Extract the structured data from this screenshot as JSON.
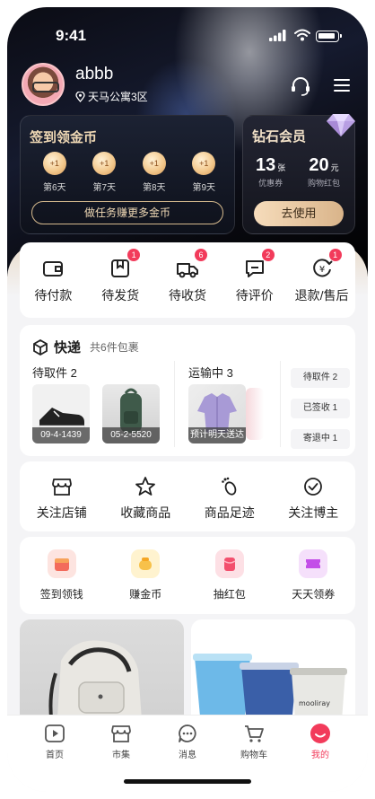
{
  "status_bar": {
    "time": "9:41"
  },
  "profile": {
    "username": "abbb",
    "location": "天马公寓3区"
  },
  "signin": {
    "title": "签到领金币",
    "days": [
      {
        "reward": "+1",
        "label": "第6天"
      },
      {
        "reward": "+1",
        "label": "第7天"
      },
      {
        "reward": "+1",
        "label": "第8天"
      },
      {
        "reward": "+1",
        "label": "第9天"
      }
    ],
    "task_button": "做任务赚更多金币"
  },
  "membership": {
    "title": "钻石会员",
    "coupons": {
      "value": "13",
      "unit": "张",
      "label": "优惠券"
    },
    "red_packet": {
      "value": "20",
      "unit": "元",
      "label": "购物红包"
    },
    "button": "去使用"
  },
  "orders": [
    {
      "label": "待付款",
      "icon": "wallet-icon",
      "badge": ""
    },
    {
      "label": "待发货",
      "icon": "package-icon",
      "badge": "1"
    },
    {
      "label": "待收货",
      "icon": "truck-icon",
      "badge": "6"
    },
    {
      "label": "待评价",
      "icon": "comment-icon",
      "badge": "2"
    },
    {
      "label": "退款/售后",
      "icon": "refund-icon",
      "badge": "1"
    }
  ],
  "express": {
    "title": "快递",
    "count_text": "共6件包裹",
    "pickup_title": "待取件 2",
    "pickup_items": [
      {
        "code": "09-4-1439",
        "icon": "sneaker-image"
      },
      {
        "code": "05-2-5520",
        "icon": "backpack-image"
      }
    ],
    "transit_title": "运输中 3",
    "transit_items": [
      {
        "code": "预计明天送达",
        "icon": "jacket-image"
      }
    ],
    "status_pills": [
      {
        "label": "待取件",
        "count": "2"
      },
      {
        "label": "已签收",
        "count": "1"
      },
      {
        "label": "寄退中",
        "count": "1"
      }
    ]
  },
  "shortcuts": [
    {
      "label": "关注店铺",
      "icon": "store-icon"
    },
    {
      "label": "收藏商品",
      "icon": "star-icon"
    },
    {
      "label": "商品足迹",
      "icon": "footprint-icon"
    },
    {
      "label": "关注博主",
      "icon": "check-circle-icon"
    }
  ],
  "activities": [
    {
      "label": "签到领钱",
      "icon": "calendar-gift-icon",
      "color": "#f36b5c"
    },
    {
      "label": "赚金币",
      "icon": "coin-jar-icon",
      "color": "#f7c14a"
    },
    {
      "label": "抽红包",
      "icon": "red-packet-icon",
      "color": "#f3506e"
    },
    {
      "label": "天天领券",
      "icon": "ticket-icon",
      "color": "#c34ee8"
    }
  ],
  "tabbar": [
    {
      "label": "首页",
      "icon": "play-icon",
      "active": false
    },
    {
      "label": "市集",
      "icon": "market-icon",
      "active": false
    },
    {
      "label": "消息",
      "icon": "chat-icon",
      "active": false
    },
    {
      "label": "购物车",
      "icon": "cart-icon",
      "active": false
    },
    {
      "label": "我的",
      "icon": "profile-smile-icon",
      "active": true
    }
  ],
  "colors": {
    "accent": "#f23b5b",
    "gold": "#f0d9b5",
    "dark": "#0b0c14"
  }
}
